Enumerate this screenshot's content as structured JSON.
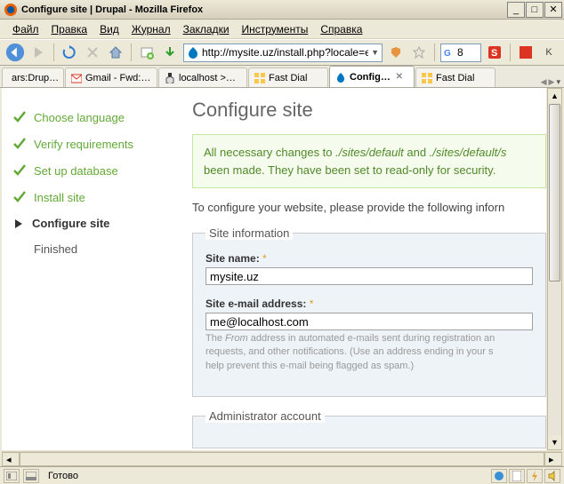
{
  "window": {
    "title": "Configure site | Drupal - Mozilla Firefox",
    "min": "_",
    "max": "□",
    "close": "✕"
  },
  "menu": [
    "Файл",
    "Правка",
    "Вид",
    "Журнал",
    "Закладки",
    "Инструменты",
    "Справка"
  ],
  "url": "http://mysite.uz/install.php?locale=en",
  "search_value": "8",
  "tabs": [
    {
      "label": "ars:Drup…",
      "icon": "firefox"
    },
    {
      "label": "Gmail - Fwd:…",
      "icon": "gmail"
    },
    {
      "label": "localhost >…",
      "icon": "pma"
    },
    {
      "label": "Fast Dial",
      "icon": "fastdial"
    },
    {
      "label": "Config…",
      "icon": "drupal",
      "active": true,
      "closable": true
    },
    {
      "label": "Fast Dial",
      "icon": "fastdial"
    }
  ],
  "steps": [
    {
      "label": "Choose language",
      "state": "done"
    },
    {
      "label": "Verify requirements",
      "state": "done"
    },
    {
      "label": "Set up database",
      "state": "done"
    },
    {
      "label": "Install site",
      "state": "done"
    },
    {
      "label": "Configure site",
      "state": "current"
    },
    {
      "label": "Finished",
      "state": "pending"
    }
  ],
  "page": {
    "title": "Configure site",
    "msg1": "All necessary changes to ",
    "msg_path1": "./sites/default",
    "msg2": " and ",
    "msg_path2": "./sites/default/s",
    "msg3": "been made. They have been set to read-only for security.",
    "intro": "To configure your website, please provide the following inforn",
    "fs1_legend": "Site information",
    "site_name_label": "Site name:",
    "site_name_value": "mysite.uz",
    "email_label": "Site e-mail address:",
    "email_value": "me@localhost.com",
    "email_desc1": "The ",
    "email_desc_em": "From",
    "email_desc2": " address in automated e-mails sent during registration an",
    "email_desc3": "requests, and other notifications. (Use an address ending in your s",
    "email_desc4": "help prevent this e-mail being flagged as spam.)",
    "fs2_legend": "Administrator account"
  },
  "status": "Готово"
}
